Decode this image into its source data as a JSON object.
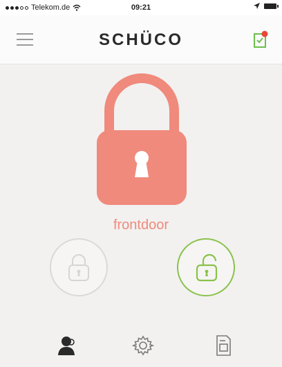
{
  "status_bar": {
    "carrier": "Telekom.de",
    "time": "09:21"
  },
  "nav": {
    "brand": "SCHÜCO",
    "menu_icon": "hamburger-icon",
    "badge_icon": "document-badge-icon"
  },
  "lock": {
    "name": "frontdoor",
    "color": "#f08a7c"
  },
  "controls": {
    "lock_icon": "padlock-closed-icon",
    "unlock_icon": "padlock-open-icon",
    "unlock_color": "#8ac24a",
    "lock_color": "#d6d5d4"
  },
  "tabs": [
    {
      "icon": "user-icon"
    },
    {
      "icon": "gear-icon"
    },
    {
      "icon": "document-icon"
    }
  ]
}
